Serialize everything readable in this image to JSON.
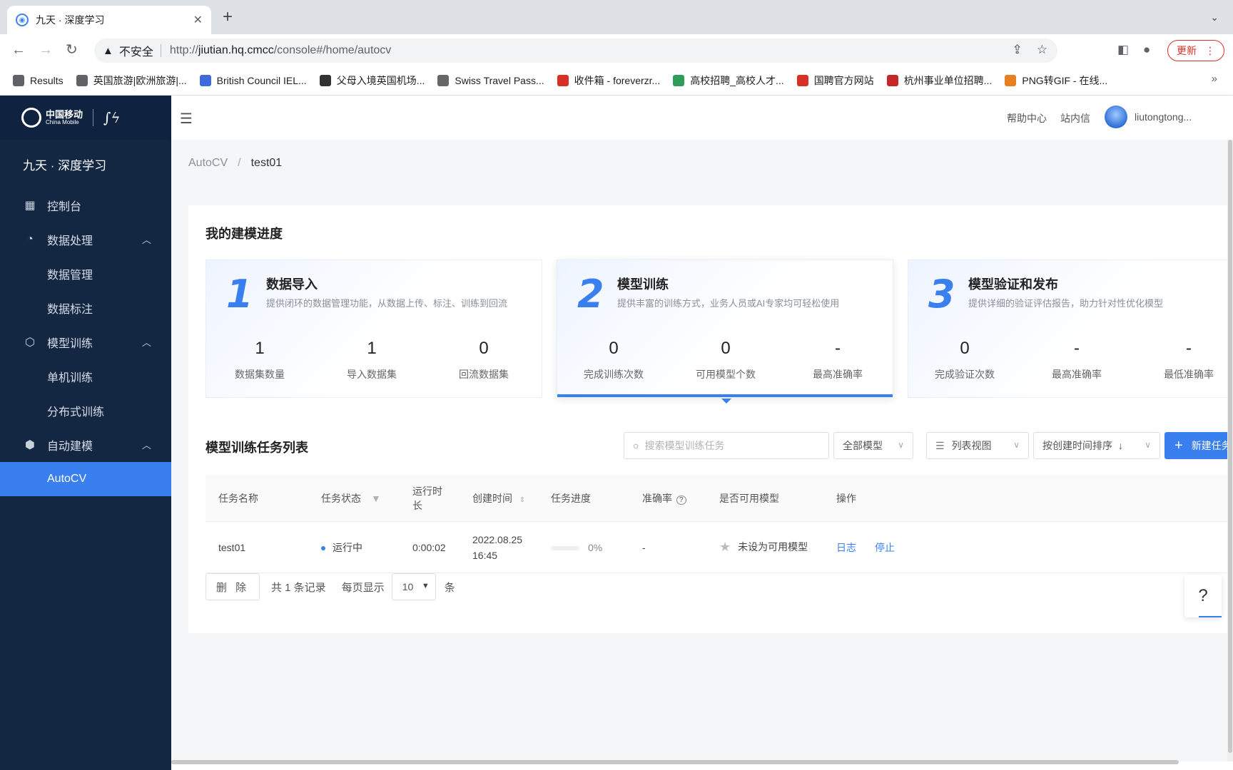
{
  "browser": {
    "tab_title": "九天 · 深度学习",
    "url_prefix": "http://",
    "url_host": "jiutian.hq.cmcc",
    "url_path": "/console#/home/autocv",
    "security_label": "不安全",
    "update_label": "更新",
    "bookmarks": [
      {
        "label": "Results",
        "color": "#5f6368"
      },
      {
        "label": "英国旅游|欧洲旅游|...",
        "color": "#5f6368"
      },
      {
        "label": "British Council IEL...",
        "color": "#3f6ad8"
      },
      {
        "label": "父母入境英国机场...",
        "color": "#333333"
      },
      {
        "label": "Swiss Travel Pass...",
        "color": "#666666"
      },
      {
        "label": "收件箱 - foreverzr...",
        "color": "#d93025"
      },
      {
        "label": "高校招聘_高校人才...",
        "color": "#2e9d5a"
      },
      {
        "label": "国聘官方网站",
        "color": "#d93025"
      },
      {
        "label": "杭州事业单位招聘...",
        "color": "#c62828"
      },
      {
        "label": "PNG转GIF - 在线...",
        "color": "#e67e22"
      }
    ]
  },
  "sidebar": {
    "logo_cn": "中国移动",
    "logo_en": "China Mobile",
    "app_title": "九天 · 深度学习",
    "items": [
      {
        "label": "控制台",
        "icon": "grid-icon"
      },
      {
        "label": "数据处理",
        "icon": "pie-chart-icon"
      },
      {
        "label": "数据管理"
      },
      {
        "label": "数据标注"
      },
      {
        "label": "模型训练",
        "icon": "model-icon"
      },
      {
        "label": "单机训练"
      },
      {
        "label": "分布式训练"
      },
      {
        "label": "自动建模",
        "icon": "cube-icon"
      },
      {
        "label": "AutoCV"
      }
    ]
  },
  "header": {
    "help_center": "帮助中心",
    "messages": "站内信",
    "username": "liutongtong..."
  },
  "breadcrumb": {
    "root": "AutoCV",
    "separator": "/",
    "current": "test01"
  },
  "progress_section": {
    "title": "我的建模进度",
    "steps": [
      {
        "num": "1",
        "title": "数据导入",
        "desc": "提供闭环的数据管理功能，从数据上传、标注、训练到回流",
        "stats": [
          {
            "value": "1",
            "label": "数据集数量"
          },
          {
            "value": "1",
            "label": "导入数据集"
          },
          {
            "value": "0",
            "label": "回流数据集"
          }
        ]
      },
      {
        "num": "2",
        "title": "模型训练",
        "desc": "提供丰富的训练方式，业务人员或AI专家均可轻松使用",
        "stats": [
          {
            "value": "0",
            "label": "完成训练次数"
          },
          {
            "value": "0",
            "label": "可用模型个数"
          },
          {
            "value": "-",
            "label": "最高准确率"
          }
        ]
      },
      {
        "num": "3",
        "title": "模型验证和发布",
        "desc": "提供详细的验证评估报告，助力针对性优化模型",
        "stats": [
          {
            "value": "0",
            "label": "完成验证次数"
          },
          {
            "value": "-",
            "label": "最高准确率"
          },
          {
            "value": "-",
            "label": "最低准确率"
          }
        ]
      }
    ]
  },
  "task_section": {
    "title": "模型训练任务列表",
    "search_placeholder": "搜索模型训练任务",
    "model_filter": "全部模型",
    "view_mode": "列表视图",
    "sort": "按创建时间排序",
    "new_task": "新建任务",
    "columns": [
      "任务名称",
      "任务状态",
      "运行时长",
      "创建时间",
      "任务进度",
      "准确率",
      "是否可用模型",
      "操作"
    ],
    "rows": [
      {
        "name": "test01",
        "status": "运行中",
        "duration": "0:00:02",
        "created_date": "2022.08.25",
        "created_time": "16:45",
        "progress_pct": "0%",
        "progress_value": 0,
        "accuracy": "-",
        "usable": "未设为可用模型",
        "action_log": "日志",
        "action_stop": "停止"
      }
    ],
    "delete_label": "删 除",
    "total_label": "共 1 条记录",
    "per_page_label": "每页显示",
    "per_page_value": "10",
    "per_page_unit": "条"
  },
  "help_button": "?"
}
